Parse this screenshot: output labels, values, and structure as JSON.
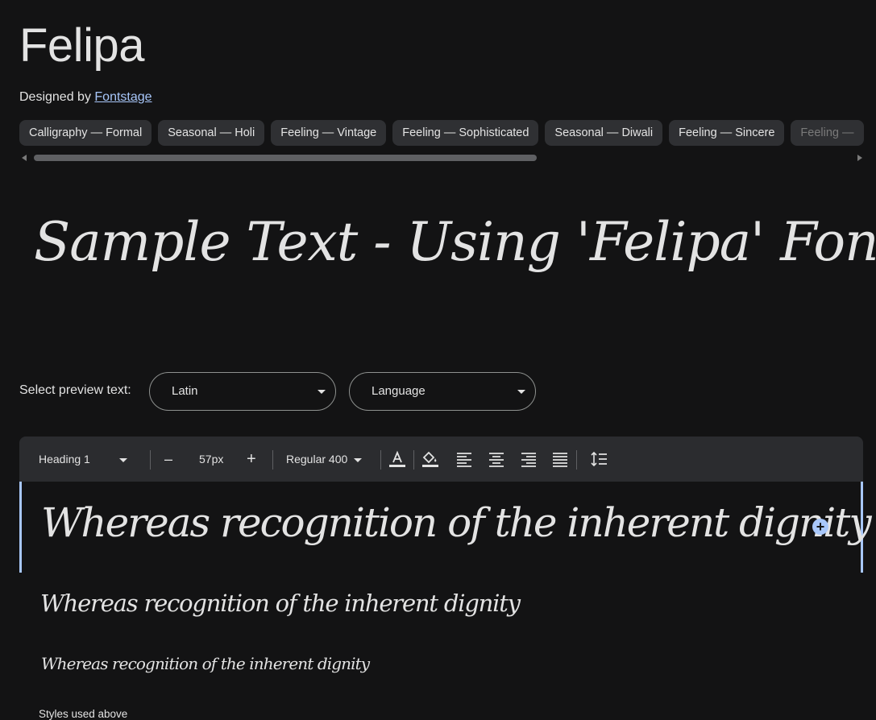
{
  "font": {
    "name": "Felipa",
    "designed_by_label": "Designed by",
    "designer": "Fontstage"
  },
  "tags": [
    "Calligraphy — Formal",
    "Seasonal — Holi",
    "Feeling — Vintage",
    "Feeling — Sophisticated",
    "Seasonal — Diwali",
    "Feeling — Sincere",
    "Feeling —"
  ],
  "hero_sample": "Sample Text - Using 'Felipa' Font.",
  "preview": {
    "label": "Select preview text:",
    "script_select": "Latin",
    "language_select": "Language"
  },
  "toolbar": {
    "style_select": "Heading 1",
    "decrease": "–",
    "size": "57px",
    "increase": "+",
    "weight_select": "Regular 400"
  },
  "editor": {
    "lines": [
      "Whereas recognition of the inherent dignity",
      "Whereas recognition of the inherent dignity",
      "Whereas recognition of the inherent dignity"
    ],
    "styles_used_label": "Styles used above"
  },
  "icons": {
    "text_color": "text-color-icon",
    "highlight": "highlight-fill-icon",
    "align_left": "align-left-icon",
    "align_center": "align-center-icon",
    "align_right": "align-right-icon",
    "align_justify": "align-justify-icon",
    "line_height": "line-height-icon",
    "add": "add-circle-icon"
  },
  "colors": {
    "background": "#131314",
    "accent": "#a8c7fa",
    "chip": "#2f3033",
    "toolbar": "#2b2c2f"
  }
}
